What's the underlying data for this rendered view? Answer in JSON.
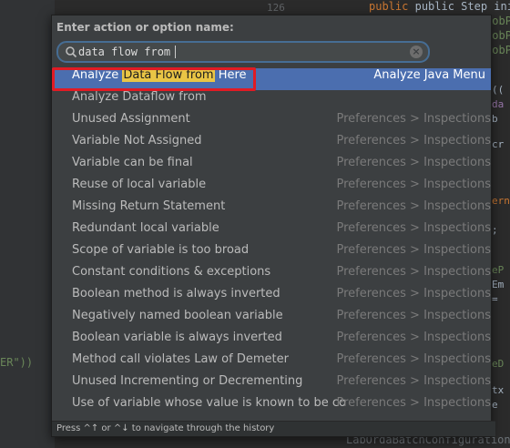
{
  "editor": {
    "line_number": "126",
    "code_top": [
      "public Step initStep(",
      "Value(\"#{jobP",
      "Value(\"#{jobP",
      "Value(\"#{jobP"
    ],
    "code_left": "ER\"))",
    "right_fragments": [
      "((",
      "da",
      "b",
      "cr",
      "ern",
      ";",
      "eP",
      "Em",
      "=",
      "eD",
      "tx",
      "e"
    ],
    "code_bottom": "LabOrdaBatchConfiguration"
  },
  "popup": {
    "title": "Enter action or option name:",
    "search_value": "data flow from",
    "clear_label": "×",
    "footer": "Press ^↑ or ^↓ to navigate through the history",
    "selected": {
      "label_before": "Analyze ",
      "label_highlight": "Data Flow from",
      "label_after": " Here",
      "group": "Analyze Java Menu"
    },
    "items": [
      {
        "label": "Analyze Dataflow from",
        "group": ""
      },
      {
        "label": "Unused Assignment",
        "group": "Preferences > Inspections"
      },
      {
        "label": "Variable Not Assigned",
        "group": "Preferences > Inspections"
      },
      {
        "label": "Variable can be final",
        "group": "Preferences > Inspections"
      },
      {
        "label": "Reuse of local variable",
        "group": "Preferences > Inspections"
      },
      {
        "label": "Missing Return Statement",
        "group": "Preferences > Inspections"
      },
      {
        "label": "Redundant local variable",
        "group": "Preferences > Inspections"
      },
      {
        "label": "Scope of variable is too broad",
        "group": "Preferences > Inspections"
      },
      {
        "label": "Constant conditions & exceptions",
        "group": "Preferences > Inspections"
      },
      {
        "label": "Boolean method is always inverted",
        "group": "Preferences > Inspections"
      },
      {
        "label": "Negatively named boolean variable",
        "group": "Preferences > Inspections"
      },
      {
        "label": "Boolean variable is always inverted",
        "group": "Preferences > Inspections"
      },
      {
        "label": "Method call violates Law of Demeter",
        "group": "Preferences > Inspections"
      },
      {
        "label": "Unused Incrementing or Decrementing",
        "group": "Preferences > Inspections"
      },
      {
        "label": "Use of variable whose value is known to be co...",
        "group": "Preferences > Inspections"
      }
    ]
  }
}
